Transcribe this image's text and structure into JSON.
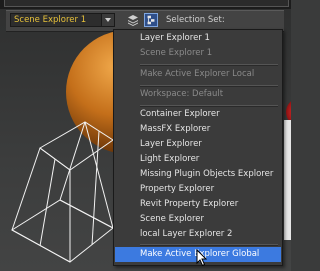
{
  "toolbar": {
    "explorer_dropdown": "Scene Explorer 1",
    "selection_set_label": "Selection Set:",
    "icons": {
      "layers": "layers-icon",
      "explorer": "scene-explorer-icon"
    }
  },
  "menu": {
    "items": [
      {
        "label": "Layer Explorer 1",
        "disabled": false
      },
      {
        "label": "Scene Explorer 1",
        "disabled": true
      },
      {
        "label": "Make Active Explorer Local",
        "disabled": true
      },
      {
        "label": "Workspace: Default",
        "disabled": true
      },
      {
        "label": "Container Explorer",
        "disabled": false
      },
      {
        "label": "MassFX Explorer",
        "disabled": false
      },
      {
        "label": "Layer Explorer",
        "disabled": false
      },
      {
        "label": "Light Explorer",
        "disabled": false
      },
      {
        "label": "Missing Plugin Objects Explorer",
        "disabled": false
      },
      {
        "label": "Property Explorer",
        "disabled": false
      },
      {
        "label": "Revit Property Explorer",
        "disabled": false
      },
      {
        "label": "Scene Explorer",
        "disabled": false
      },
      {
        "label": "local Layer Explorer 2",
        "disabled": false
      },
      {
        "label": "Make Active Explorer Global",
        "disabled": false,
        "highlighted": true
      }
    ]
  },
  "colors": {
    "accent": "#e8c23a",
    "highlight": "#3c7ae0",
    "menu_bg": "#3b3b3b",
    "disabled_text": "#8a8a8a"
  }
}
